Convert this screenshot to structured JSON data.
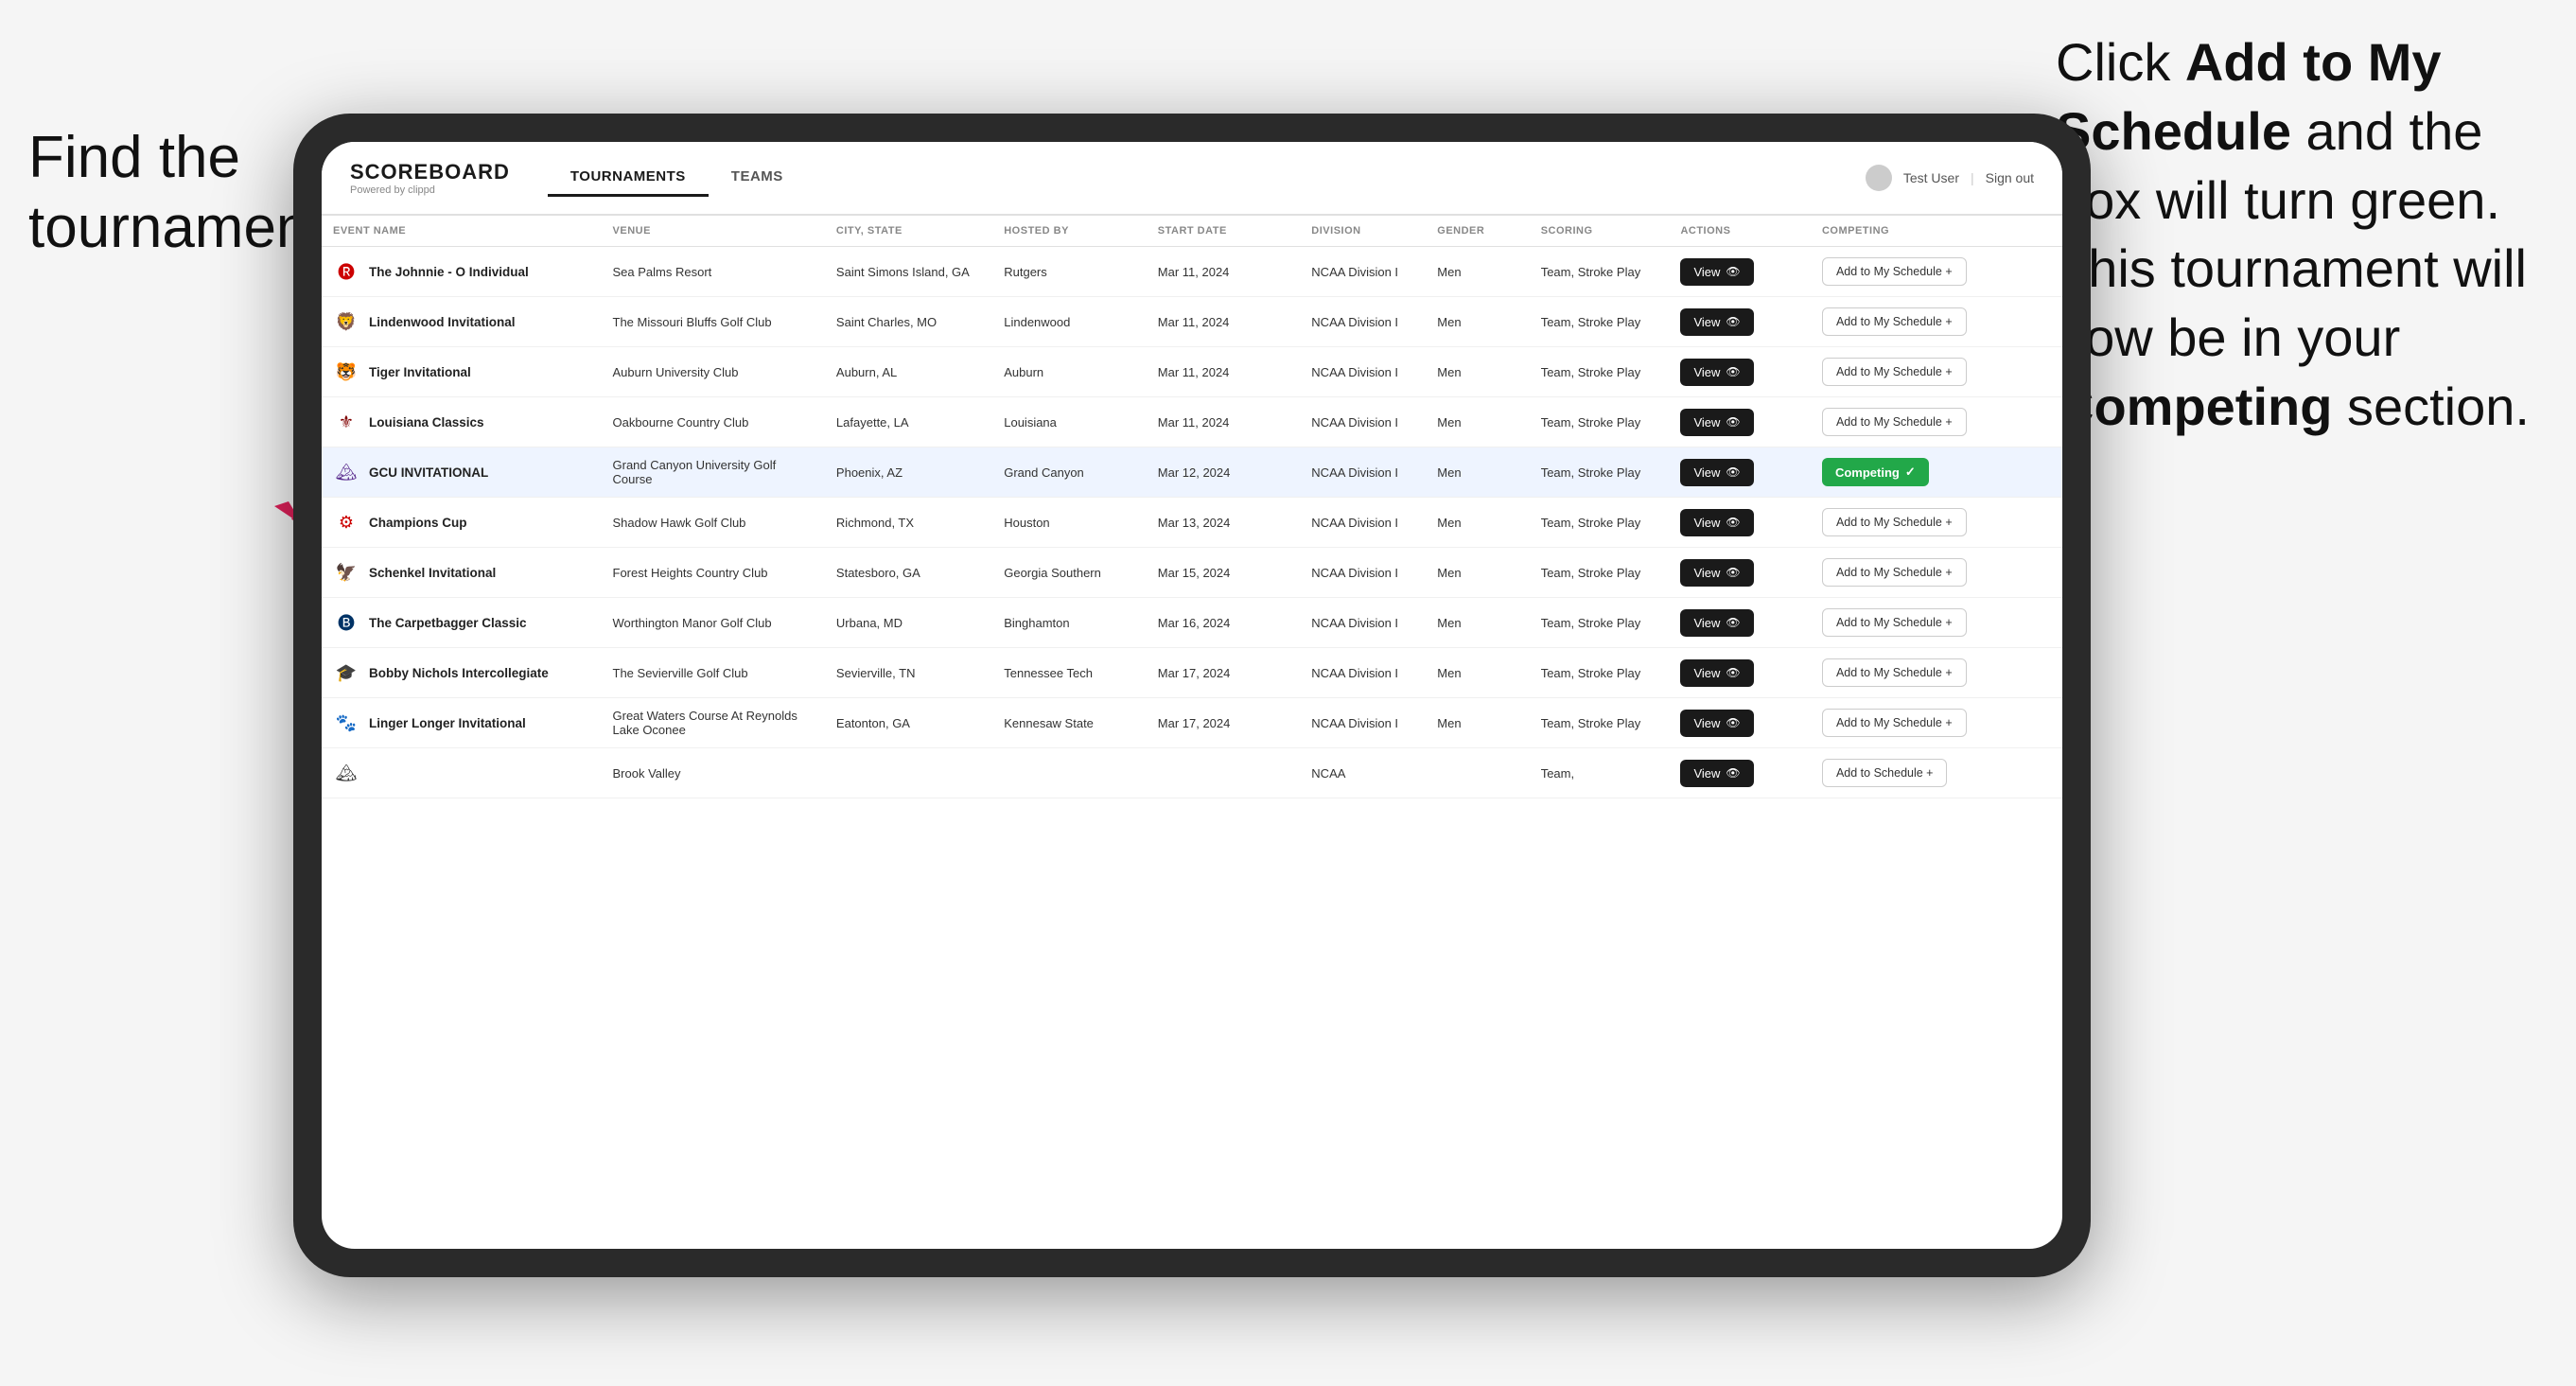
{
  "annotations": {
    "left_title": "Find the tournament.",
    "right_title": "Click ",
    "right_bold1": "Add to My Schedule",
    "right_mid": " and the box will turn green. This tournament will now be in your ",
    "right_bold2": "Competing",
    "right_end": " section."
  },
  "app": {
    "logo": "SCOREBOARD",
    "logo_sub": "Powered by clippd",
    "nav": [
      "TOURNAMENTS",
      "TEAMS"
    ],
    "active_nav": "TOURNAMENTS",
    "user": "Test User",
    "sign_out": "Sign out"
  },
  "table": {
    "columns": [
      "EVENT NAME",
      "VENUE",
      "CITY, STATE",
      "HOSTED BY",
      "START DATE",
      "DIVISION",
      "GENDER",
      "SCORING",
      "ACTIONS",
      "COMPETING"
    ],
    "rows": [
      {
        "logo": "🅡",
        "logo_color": "#cc0000",
        "name": "The Johnnie - O Individual",
        "venue": "Sea Palms Resort",
        "city": "Saint Simons Island, GA",
        "host": "Rutgers",
        "date": "Mar 11, 2024",
        "division": "NCAA Division I",
        "gender": "Men",
        "scoring": "Team, Stroke Play",
        "action": "View",
        "competing": "Add to My Schedule +",
        "competing_type": "add",
        "highlighted": false
      },
      {
        "logo": "🦁",
        "logo_color": "#004080",
        "name": "Lindenwood Invitational",
        "venue": "The Missouri Bluffs Golf Club",
        "city": "Saint Charles, MO",
        "host": "Lindenwood",
        "date": "Mar 11, 2024",
        "division": "NCAA Division I",
        "gender": "Men",
        "scoring": "Team, Stroke Play",
        "action": "View",
        "competing": "Add to My Schedule +",
        "competing_type": "add",
        "highlighted": false
      },
      {
        "logo": "🐯",
        "logo_color": "#ff6600",
        "name": "Tiger Invitational",
        "venue": "Auburn University Club",
        "city": "Auburn, AL",
        "host": "Auburn",
        "date": "Mar 11, 2024",
        "division": "NCAA Division I",
        "gender": "Men",
        "scoring": "Team, Stroke Play",
        "action": "View",
        "competing": "Add to My Schedule +",
        "competing_type": "add",
        "highlighted": false
      },
      {
        "logo": "⚜",
        "logo_color": "#800000",
        "name": "Louisiana Classics",
        "venue": "Oakbourne Country Club",
        "city": "Lafayette, LA",
        "host": "Louisiana",
        "date": "Mar 11, 2024",
        "division": "NCAA Division I",
        "gender": "Men",
        "scoring": "Team, Stroke Play",
        "action": "View",
        "competing": "Add to My Schedule +",
        "competing_type": "add",
        "highlighted": false
      },
      {
        "logo": "🏔",
        "logo_color": "#5b2d8e",
        "name": "GCU INVITATIONAL",
        "venue": "Grand Canyon University Golf Course",
        "city": "Phoenix, AZ",
        "host": "Grand Canyon",
        "date": "Mar 12, 2024",
        "division": "NCAA Division I",
        "gender": "Men",
        "scoring": "Team, Stroke Play",
        "action": "View",
        "competing": "Competing ✓",
        "competing_type": "competing",
        "highlighted": true
      },
      {
        "logo": "⚙",
        "logo_color": "#cc0000",
        "name": "Champions Cup",
        "venue": "Shadow Hawk Golf Club",
        "city": "Richmond, TX",
        "host": "Houston",
        "date": "Mar 13, 2024",
        "division": "NCAA Division I",
        "gender": "Men",
        "scoring": "Team, Stroke Play",
        "action": "View",
        "competing": "Add to My Schedule +",
        "competing_type": "add",
        "highlighted": false
      },
      {
        "logo": "🦅",
        "logo_color": "#003366",
        "name": "Schenkel Invitational",
        "venue": "Forest Heights Country Club",
        "city": "Statesboro, GA",
        "host": "Georgia Southern",
        "date": "Mar 15, 2024",
        "division": "NCAA Division I",
        "gender": "Men",
        "scoring": "Team, Stroke Play",
        "action": "View",
        "competing": "Add to My Schedule +",
        "competing_type": "add",
        "highlighted": false
      },
      {
        "logo": "🅑",
        "logo_color": "#003366",
        "name": "The Carpetbagger Classic",
        "venue": "Worthington Manor Golf Club",
        "city": "Urbana, MD",
        "host": "Binghamton",
        "date": "Mar 16, 2024",
        "division": "NCAA Division I",
        "gender": "Men",
        "scoring": "Team, Stroke Play",
        "action": "View",
        "competing": "Add to My Schedule +",
        "competing_type": "add",
        "highlighted": false
      },
      {
        "logo": "🎓",
        "logo_color": "#ffa500",
        "name": "Bobby Nichols Intercollegiate",
        "venue": "The Sevierville Golf Club",
        "city": "Sevierville, TN",
        "host": "Tennessee Tech",
        "date": "Mar 17, 2024",
        "division": "NCAA Division I",
        "gender": "Men",
        "scoring": "Team, Stroke Play",
        "action": "View",
        "competing": "Add to My Schedule +",
        "competing_type": "add",
        "highlighted": false
      },
      {
        "logo": "🐾",
        "logo_color": "#cc6600",
        "name": "Linger Longer Invitational",
        "venue": "Great Waters Course At Reynolds Lake Oconee",
        "city": "Eatonton, GA",
        "host": "Kennesaw State",
        "date": "Mar 17, 2024",
        "division": "NCAA Division I",
        "gender": "Men",
        "scoring": "Team, Stroke Play",
        "action": "View",
        "competing": "Add to My Schedule +",
        "competing_type": "add",
        "highlighted": false
      },
      {
        "logo": "🏔",
        "logo_color": "#333",
        "name": "",
        "venue": "Brook Valley",
        "city": "",
        "host": "",
        "date": "",
        "division": "NCAA",
        "gender": "",
        "scoring": "Team,",
        "action": "View",
        "competing": "Add to Schedule +",
        "competing_type": "add",
        "highlighted": false
      }
    ]
  }
}
